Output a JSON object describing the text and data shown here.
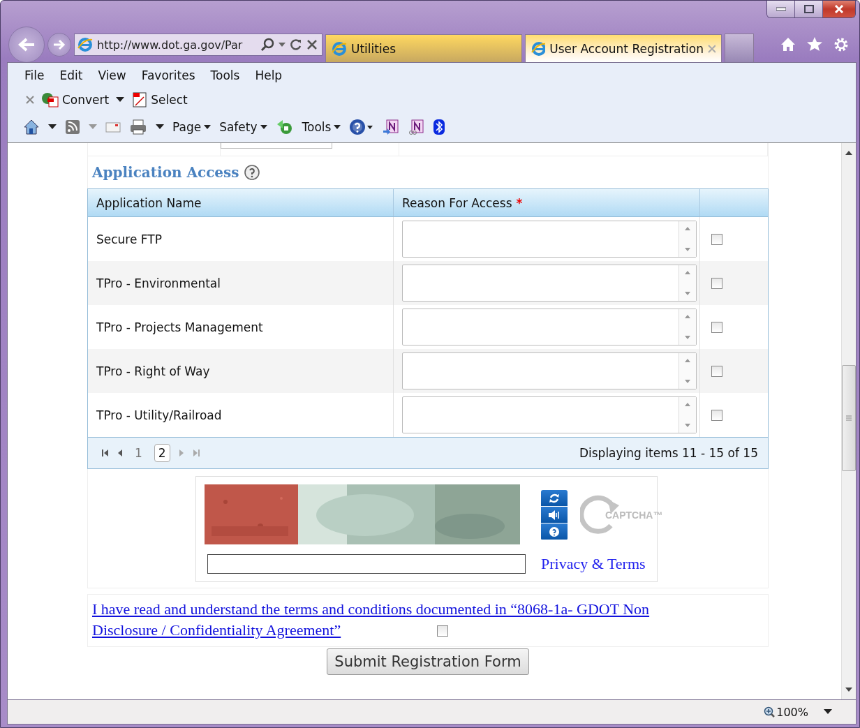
{
  "address_bar": {
    "url": "http://www.dot.ga.gov/Par"
  },
  "tabs": [
    {
      "label": "Utilities",
      "selected": false
    },
    {
      "label": "User Account Registration",
      "selected": true
    }
  ],
  "menu": [
    "File",
    "Edit",
    "View",
    "Favorites",
    "Tools",
    "Help"
  ],
  "pdf_toolbar": [
    "Convert",
    "Select"
  ],
  "command_bar": [
    "Page",
    "Safety",
    "Tools"
  ],
  "section": {
    "title": "Application Access"
  },
  "table": {
    "columns": [
      {
        "label": "Application Name",
        "required": false
      },
      {
        "label": "Reason For Access",
        "required": true
      }
    ],
    "required_mark": "*",
    "rows": [
      {
        "name": "Secure FTP",
        "checked": false
      },
      {
        "name": "TPro - Environmental",
        "checked": false
      },
      {
        "name": "TPro - Projects Management",
        "checked": false
      },
      {
        "name": "TPro - Right of Way",
        "checked": false
      },
      {
        "name": "TPro - Utility/Railroad",
        "checked": false
      }
    ]
  },
  "pager": {
    "pages": [
      {
        "label": "1",
        "selected": false
      },
      {
        "label": "2",
        "selected": true
      }
    ],
    "summary": "Displaying items 11 - 15 of 15"
  },
  "captcha": {
    "logo": "CAPTCHA™",
    "link": "Privacy & Terms"
  },
  "agreement": {
    "text": "I have read and understand the terms and conditions documented in “8068-1a- GDOT Non Disclosure / Confidentiality Agreement”",
    "checked": false
  },
  "submit": "Submit Registration Form",
  "status_bar": {
    "zoom": "100%"
  }
}
